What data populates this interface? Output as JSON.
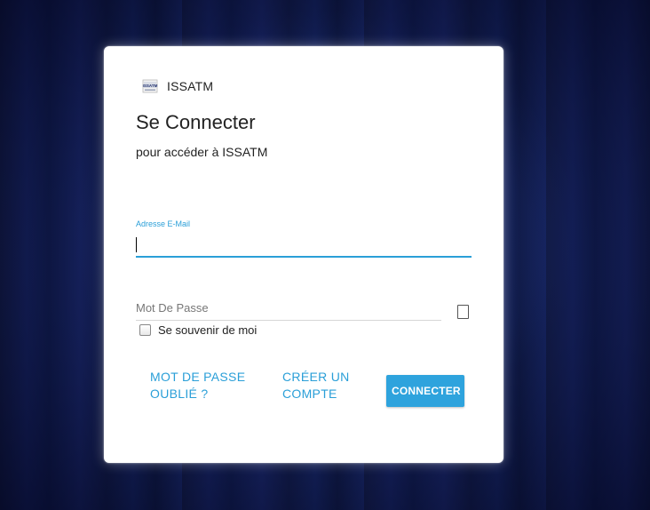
{
  "brand": {
    "name": "ISSATM",
    "logo_icon": "issatm-logo-icon",
    "logo_text": "ISSATM"
  },
  "login": {
    "title": "Se Connecter",
    "subtitle": "pour accéder à ISSATM",
    "email": {
      "label": "Adresse E-Mail",
      "value": ""
    },
    "password": {
      "placeholder": "Mot De Passe",
      "value": "",
      "toggle_icon": "show-password-icon"
    },
    "remember_me": {
      "label": "Se souvenir de moi",
      "checked": false
    },
    "links": {
      "forgot_password": "MOT DE PASSE OUBLIÉ ?",
      "create_account": "CRÉER UN COMPTE"
    },
    "submit_label": "CONNECTER"
  },
  "colors": {
    "accent": "#2a9fd8",
    "button": "#2ea3dd",
    "background": "#101a4a",
    "card": "#ffffff"
  }
}
